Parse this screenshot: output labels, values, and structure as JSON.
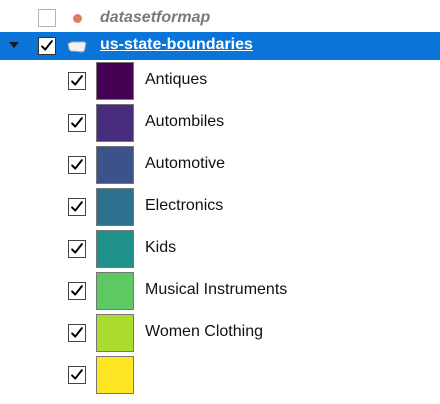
{
  "layers": [
    {
      "name": "datasetformap",
      "checked": false,
      "geometry": "point",
      "icon": "point-dot-icon",
      "icon_color": "#e07b62"
    },
    {
      "name": "us-state-boundaries",
      "checked": true,
      "selected": true,
      "expanded": true,
      "geometry": "polygon",
      "icon": "polygon-icon",
      "highlight_color": "#0a74d8",
      "legend": [
        {
          "label": "Antiques",
          "color": "#440154",
          "checked": true
        },
        {
          "label": "Autombiles",
          "color": "#472d7b",
          "checked": true
        },
        {
          "label": "Automotive",
          "color": "#3b528b",
          "checked": true
        },
        {
          "label": "Electronics",
          "color": "#2c728e",
          "checked": true
        },
        {
          "label": "Kids",
          "color": "#21918c",
          "checked": true
        },
        {
          "label": "Musical Instruments",
          "color": "#5ec962",
          "checked": true
        },
        {
          "label": "Women Clothing",
          "color": "#addc30",
          "checked": true
        },
        {
          "label": "",
          "color": "#fde725",
          "checked": true
        }
      ]
    }
  ]
}
